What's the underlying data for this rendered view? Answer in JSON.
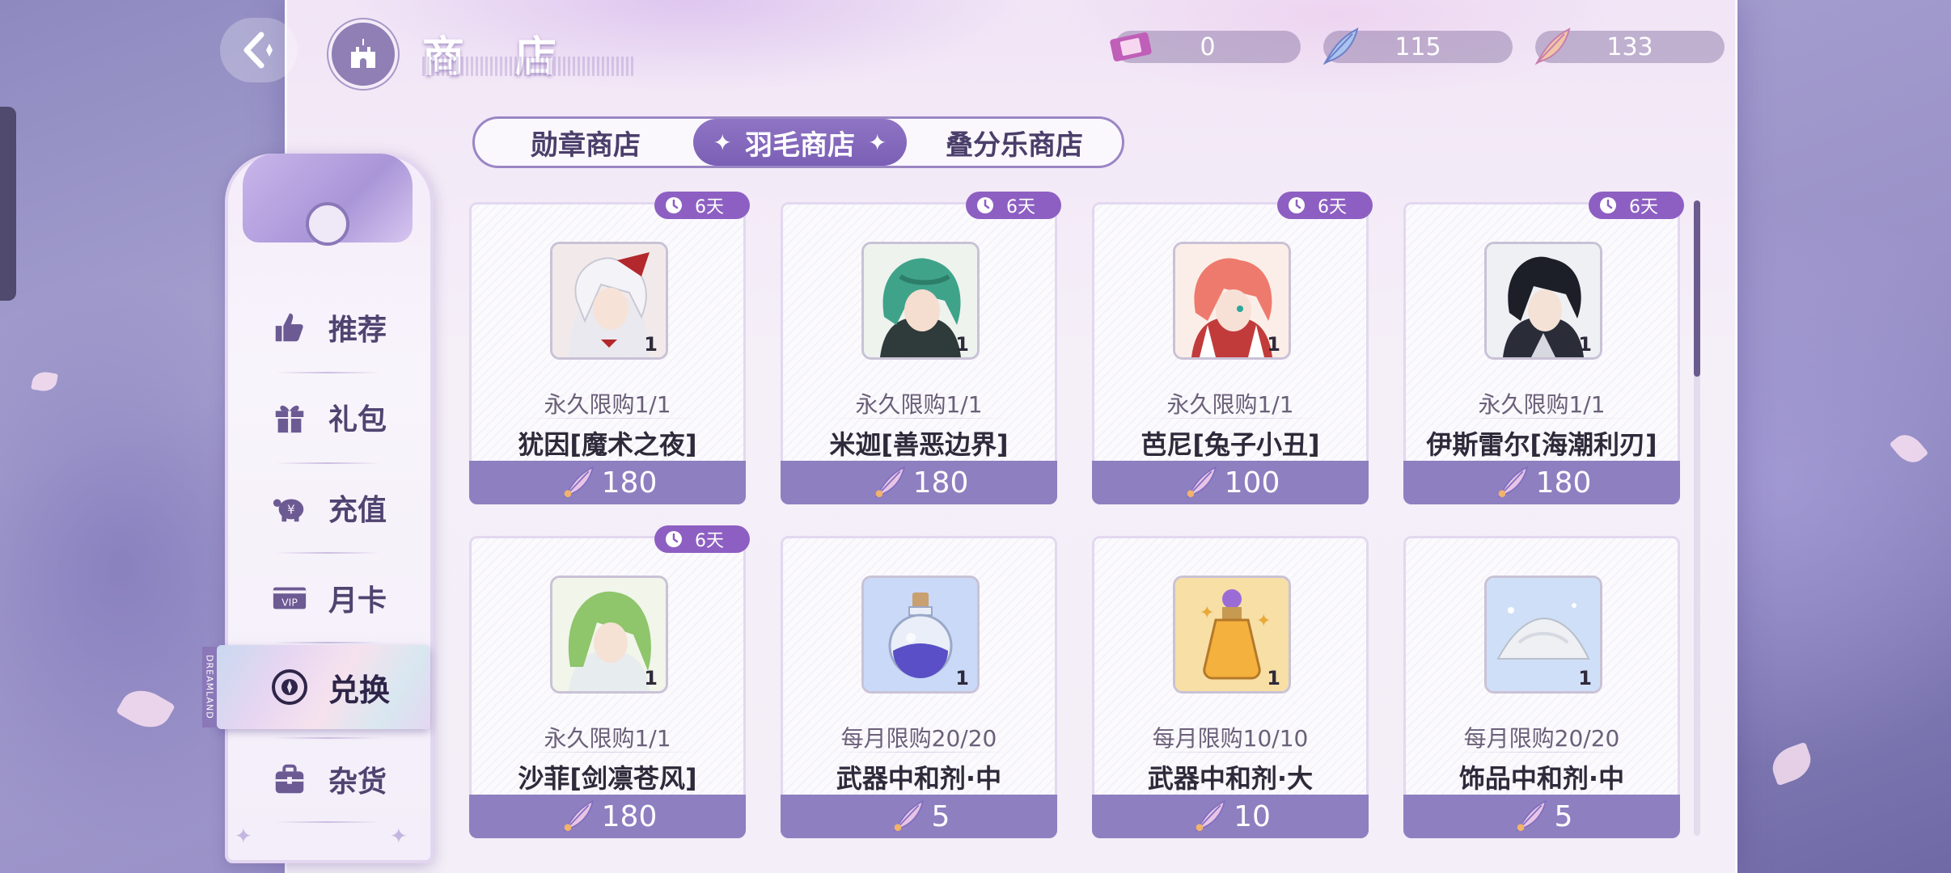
{
  "header": {
    "title": "商 店",
    "currencies": [
      {
        "name": "ticket-icon",
        "value": "0"
      },
      {
        "name": "feather-icon",
        "value": "115"
      },
      {
        "name": "gold-feather-icon",
        "value": "133"
      }
    ]
  },
  "tabs": [
    {
      "label": "勋章商店",
      "active": false
    },
    {
      "label": "羽毛商店",
      "active": true
    },
    {
      "label": "叠分乐商店",
      "active": false
    }
  ],
  "nav": {
    "badge": "DREAMLAND",
    "items": [
      {
        "label": "推荐",
        "icon": "thumbs-up-icon"
      },
      {
        "label": "礼包",
        "icon": "gift-icon"
      },
      {
        "label": "充值",
        "icon": "piggy-bank-icon"
      },
      {
        "label": "月卡",
        "icon": "vip-card-icon"
      },
      {
        "label": "兑换",
        "icon": "exchange-icon",
        "active": true
      },
      {
        "label": "杂货",
        "icon": "bag-icon"
      }
    ]
  },
  "items": [
    {
      "timer": "6天",
      "qty": "1",
      "limit": "永久限购1/1",
      "name": "犹因[魔术之夜]",
      "price": "180",
      "image": "portrait-white-hair"
    },
    {
      "timer": "6天",
      "qty": "1",
      "limit": "永久限购1/1",
      "name": "米迦[善恶边界]",
      "price": "180",
      "image": "portrait-green-hair"
    },
    {
      "timer": "6天",
      "qty": "1",
      "limit": "永久限购1/1",
      "name": "芭尼[兔子小丑]",
      "price": "100",
      "image": "portrait-red-hair"
    },
    {
      "timer": "6天",
      "qty": "1",
      "limit": "永久限购1/1",
      "name": "伊斯雷尔[海潮利刃]",
      "price": "180",
      "image": "portrait-black-hair"
    },
    {
      "timer": "6天",
      "qty": "1",
      "limit": "永久限购1/1",
      "name": "沙菲[剑凛苍风]",
      "price": "180",
      "image": "portrait-light-green-hair"
    },
    {
      "timer": "",
      "qty": "1",
      "limit": "每月限购20/20",
      "name": "武器中和剂·中",
      "price": "5",
      "image": "purple-potion-icon"
    },
    {
      "timer": "",
      "qty": "1",
      "limit": "每月限购10/10",
      "name": "武器中和剂·大",
      "price": "10",
      "image": "gold-potion-icon"
    },
    {
      "timer": "",
      "qty": "1",
      "limit": "每月限购20/20",
      "name": "饰品中和剂·中",
      "price": "5",
      "image": "powder-pile-icon"
    }
  ]
}
